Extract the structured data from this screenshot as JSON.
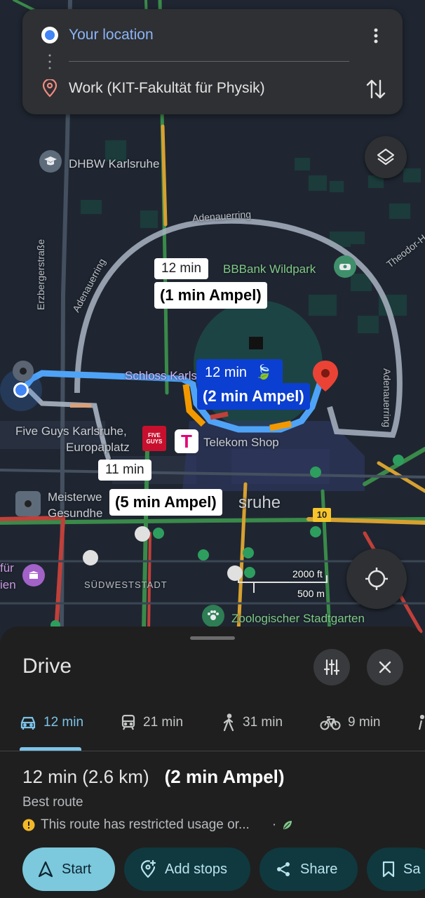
{
  "route_card": {
    "origin": "Your location",
    "destination": "Work (KIT-Fakultät für Physik)"
  },
  "map": {
    "labels": {
      "dhbw": "DHBW Karlsruhe",
      "erzberger": "Erzbergerstraße",
      "adenauer_top": "Adenauerring",
      "adenauer_left": "Adenauerring",
      "adenauer_right": "Adenauerring",
      "theodor": "Theodor-H",
      "wildpark": "BBBank Wildpark",
      "schloss": "Schloss Karlsruhe",
      "fiveguys1": "Five Guys Karlsruhe,",
      "fiveguys2": "Europaplatz",
      "telekom": "Telekom Shop",
      "meister1": "Meisterwe",
      "meister2": "Gesundhe",
      "ruhe": "sruhe",
      "fuer1": "für",
      "fuer2": "ien",
      "suedweststadt": "SÜDWESTSTADT",
      "zoo": "Zoologischer Stadtgarten",
      "road_number": "10",
      "scale_ft": "2000 ft",
      "scale_m": "500 m",
      "fiveguys_logo": "FIVE GUYS"
    },
    "bubbles": {
      "alt1_time": "12 min",
      "alt1_note": "(1 min Ampel)",
      "main_time": "12 min",
      "main_note": "(2 min Ampel)",
      "alt2_time": "11 min",
      "alt2_note": "(5 min Ampel)"
    }
  },
  "sheet": {
    "title": "Drive",
    "modes": [
      {
        "icon": "car-icon",
        "label": "12 min"
      },
      {
        "icon": "transit-icon",
        "label": "21 min"
      },
      {
        "icon": "walk-icon",
        "label": "31 min"
      },
      {
        "icon": "bike-icon",
        "label": "9 min"
      }
    ],
    "summary": "12 min (2.6 km)",
    "summary_note": "(2 min Ampel)",
    "best_route": "Best route",
    "warning": "This route has restricted usage or...",
    "buttons": {
      "start": "Start",
      "add_stops": "Add stops",
      "share": "Share",
      "save": "Sa"
    }
  },
  "colors": {
    "route_main": "#4fa3f7",
    "route_alt": "#a9b4c2",
    "accent": "#7cc8dc",
    "pin_red": "#ea4335"
  }
}
